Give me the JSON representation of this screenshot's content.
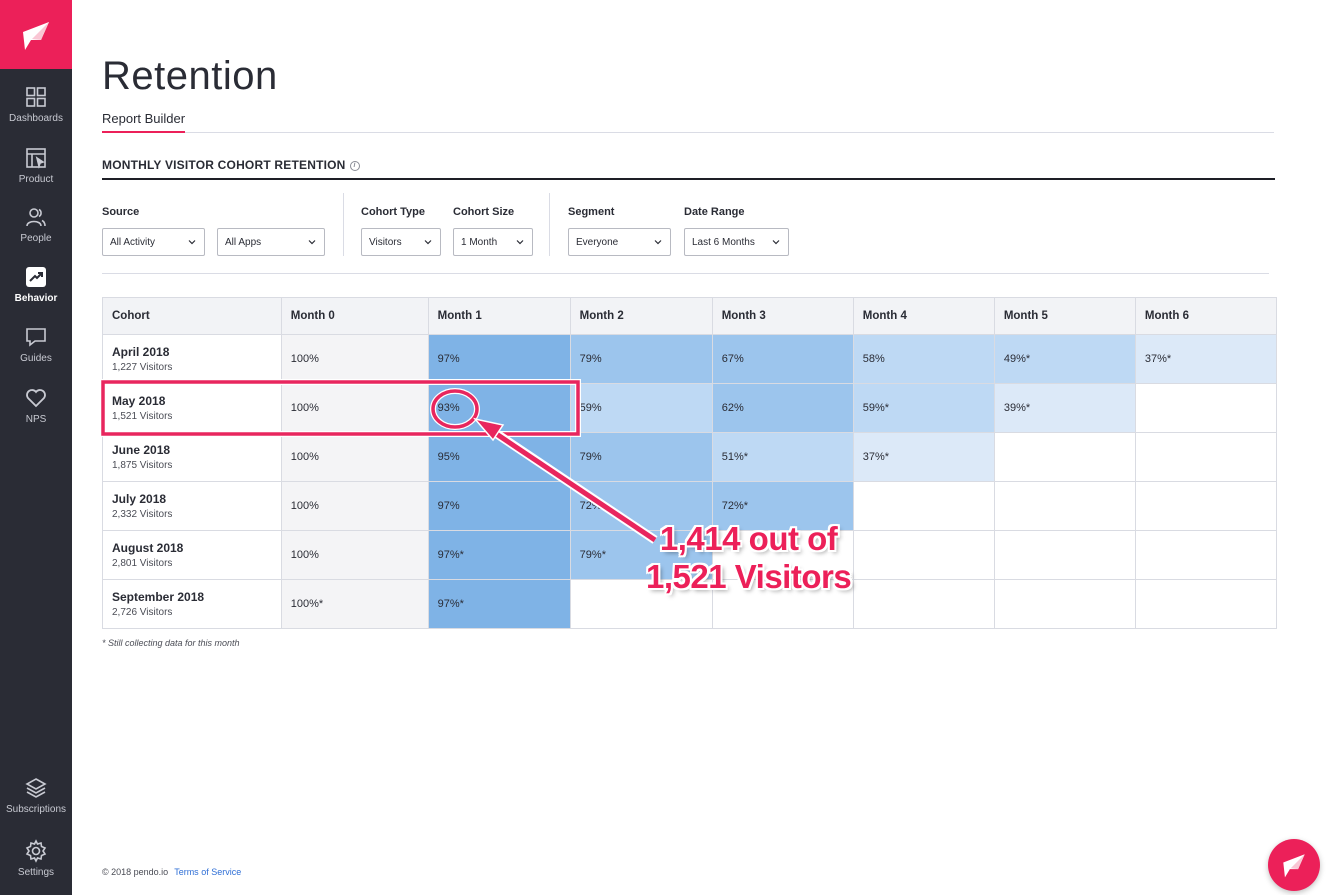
{
  "sidebar": {
    "items": [
      {
        "label": "Dashboards",
        "icon": "dashboards-icon"
      },
      {
        "label": "Product",
        "icon": "product-icon"
      },
      {
        "label": "People",
        "icon": "people-icon"
      },
      {
        "label": "Behavior",
        "icon": "behavior-icon",
        "active": true
      },
      {
        "label": "Guides",
        "icon": "guides-icon"
      },
      {
        "label": "NPS",
        "icon": "nps-heart-icon"
      }
    ],
    "bottom_items": [
      {
        "label": "Subscriptions",
        "icon": "subscriptions-icon"
      },
      {
        "label": "Settings",
        "icon": "settings-gear-icon"
      }
    ]
  },
  "page": {
    "title": "Retention",
    "tab": "Report Builder",
    "section_title": "MONTHLY VISITOR COHORT RETENTION",
    "info_glyph": "i"
  },
  "filters": {
    "source": {
      "label": "Source",
      "activity": "All Activity",
      "apps": "All Apps"
    },
    "cohort_type": {
      "label": "Cohort Type",
      "value": "Visitors"
    },
    "cohort_size": {
      "label": "Cohort Size",
      "value": "1 Month"
    },
    "segment": {
      "label": "Segment",
      "value": "Everyone"
    },
    "date_range": {
      "label": "Date Range",
      "value": "Last 6 Months"
    }
  },
  "table": {
    "headers": [
      "Cohort",
      "Month 0",
      "Month 1",
      "Month 2",
      "Month 3",
      "Month 4",
      "Month 5",
      "Month 6"
    ],
    "rows": [
      {
        "cohort": "April 2018",
        "visitors": "1,227 Visitors",
        "cells": [
          "100%",
          "97%",
          "79%",
          "67%",
          "58%",
          "49%*",
          "37%*"
        ]
      },
      {
        "cohort": "May 2018",
        "visitors": "1,521 Visitors",
        "cells": [
          "100%",
          "93%",
          "59%",
          "62%",
          "59%*",
          "39%*",
          ""
        ]
      },
      {
        "cohort": "June 2018",
        "visitors": "1,875 Visitors",
        "cells": [
          "100%",
          "95%",
          "79%",
          "51%*",
          "37%*",
          "",
          ""
        ]
      },
      {
        "cohort": "July 2018",
        "visitors": "2,332 Visitors",
        "cells": [
          "100%",
          "97%",
          "72%*",
          "72%*",
          "",
          "",
          ""
        ]
      },
      {
        "cohort": "August 2018",
        "visitors": "2,801 Visitors",
        "cells": [
          "100%",
          "97%*",
          "79%*",
          "",
          "",
          "",
          ""
        ]
      },
      {
        "cohort": "September 2018",
        "visitors": "2,726 Visitors",
        "cells": [
          "100%*",
          "97%*",
          "",
          "",
          "",
          "",
          ""
        ]
      }
    ],
    "footnote": "* Still collecting data for this month"
  },
  "colors": {
    "accent": "#ec2059",
    "sidebar_bg": "#2a2c35",
    "heat_dark": "#7fb3e6",
    "heat_mid": "#9cc5ed",
    "heat_light": "#bed9f4",
    "heat_pale": "#dce9f8"
  },
  "annotation": {
    "callout_line1": "1,414 out of",
    "callout_line2": "1,521 Visitors"
  },
  "footer": {
    "copyright": "© 2018 pendo.io",
    "terms_link": "Terms of Service"
  }
}
